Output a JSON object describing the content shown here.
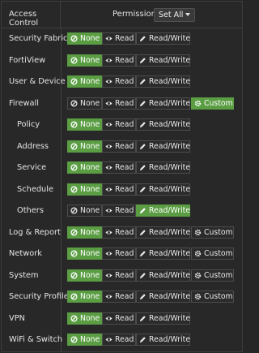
{
  "header": {
    "access_control": "Access Control",
    "permissions": "Permissions",
    "set_all": "Set All"
  },
  "labels": {
    "none": "None",
    "read": "Read",
    "read_write": "Read/Write",
    "custom": "Custom"
  },
  "colors": {
    "active": "#5a9d43"
  },
  "rows": [
    {
      "label": "Security Fabric",
      "sub": false,
      "selected": "none",
      "custom": false
    },
    {
      "label": "FortiView",
      "sub": false,
      "selected": "none",
      "custom": false
    },
    {
      "label": "User & Device",
      "sub": false,
      "selected": "none",
      "custom": false
    },
    {
      "label": "Firewall",
      "sub": false,
      "selected": "custom",
      "custom": true
    },
    {
      "label": "Policy",
      "sub": true,
      "selected": "none",
      "custom": false
    },
    {
      "label": "Address",
      "sub": true,
      "selected": "none",
      "custom": false
    },
    {
      "label": "Service",
      "sub": true,
      "selected": "none",
      "custom": false
    },
    {
      "label": "Schedule",
      "sub": true,
      "selected": "none",
      "custom": false
    },
    {
      "label": "Others",
      "sub": true,
      "selected": "read_write",
      "custom": false
    },
    {
      "label": "Log & Report",
      "sub": false,
      "selected": "none",
      "custom": true
    },
    {
      "label": "Network",
      "sub": false,
      "selected": "none",
      "custom": true
    },
    {
      "label": "System",
      "sub": false,
      "selected": "none",
      "custom": true
    },
    {
      "label": "Security Profile",
      "sub": false,
      "selected": "none",
      "custom": true
    },
    {
      "label": "VPN",
      "sub": false,
      "selected": "none",
      "custom": false
    },
    {
      "label": "WiFi & Switch",
      "sub": false,
      "selected": "none",
      "custom": false
    }
  ]
}
